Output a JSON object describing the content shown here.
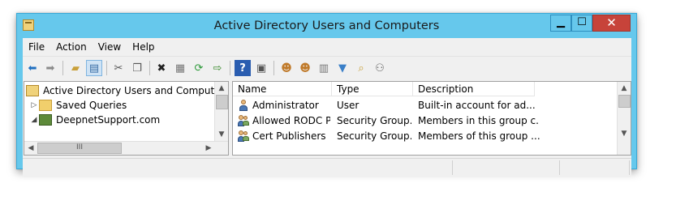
{
  "window": {
    "title": "Active Directory Users and Computers"
  },
  "title_buttons": {
    "minimize": "▁",
    "maximize": "☐",
    "close": "✕"
  },
  "menu": {
    "file": "File",
    "action": "Action",
    "view": "View",
    "help": "Help"
  },
  "toolbar_icons": [
    "back-icon",
    "forward-icon",
    "up-folder-icon",
    "show-hide-tree-icon",
    "cut-icon",
    "copy-icon",
    "delete-icon",
    "properties-icon",
    "refresh-icon",
    "export-list-icon",
    "help-icon",
    "console-icon",
    "new-user-icon",
    "new-group-icon",
    "new-ou-icon",
    "filter-icon",
    "find-icon",
    "add-to-group-icon"
  ],
  "tree": {
    "root": "Active Directory Users and Computers [V",
    "items": [
      {
        "label": "Saved Queries",
        "expander": "▷"
      },
      {
        "label": "DeepnetSupport.com",
        "expander": "◢"
      }
    ]
  },
  "list": {
    "columns": [
      "Name",
      "Type",
      "Description"
    ],
    "rows": [
      {
        "name": "Administrator",
        "type": "User",
        "description": "Built-in account for ad...",
        "icon": "user-icon"
      },
      {
        "name": "Allowed RODC P...",
        "type": "Security Group...",
        "description": "Members in this group c...",
        "icon": "group-icon"
      },
      {
        "name": "Cert Publishers",
        "type": "Security Group...",
        "description": "Members of this group ...",
        "icon": "group-icon"
      }
    ]
  },
  "scroll": {
    "up": "▲",
    "down": "▼",
    "left": "◀",
    "right": "▶",
    "grip": "III"
  },
  "colors": {
    "titlebar": "#66c8ec",
    "close_button": "#c7433a",
    "client": "#f0f0f0"
  }
}
